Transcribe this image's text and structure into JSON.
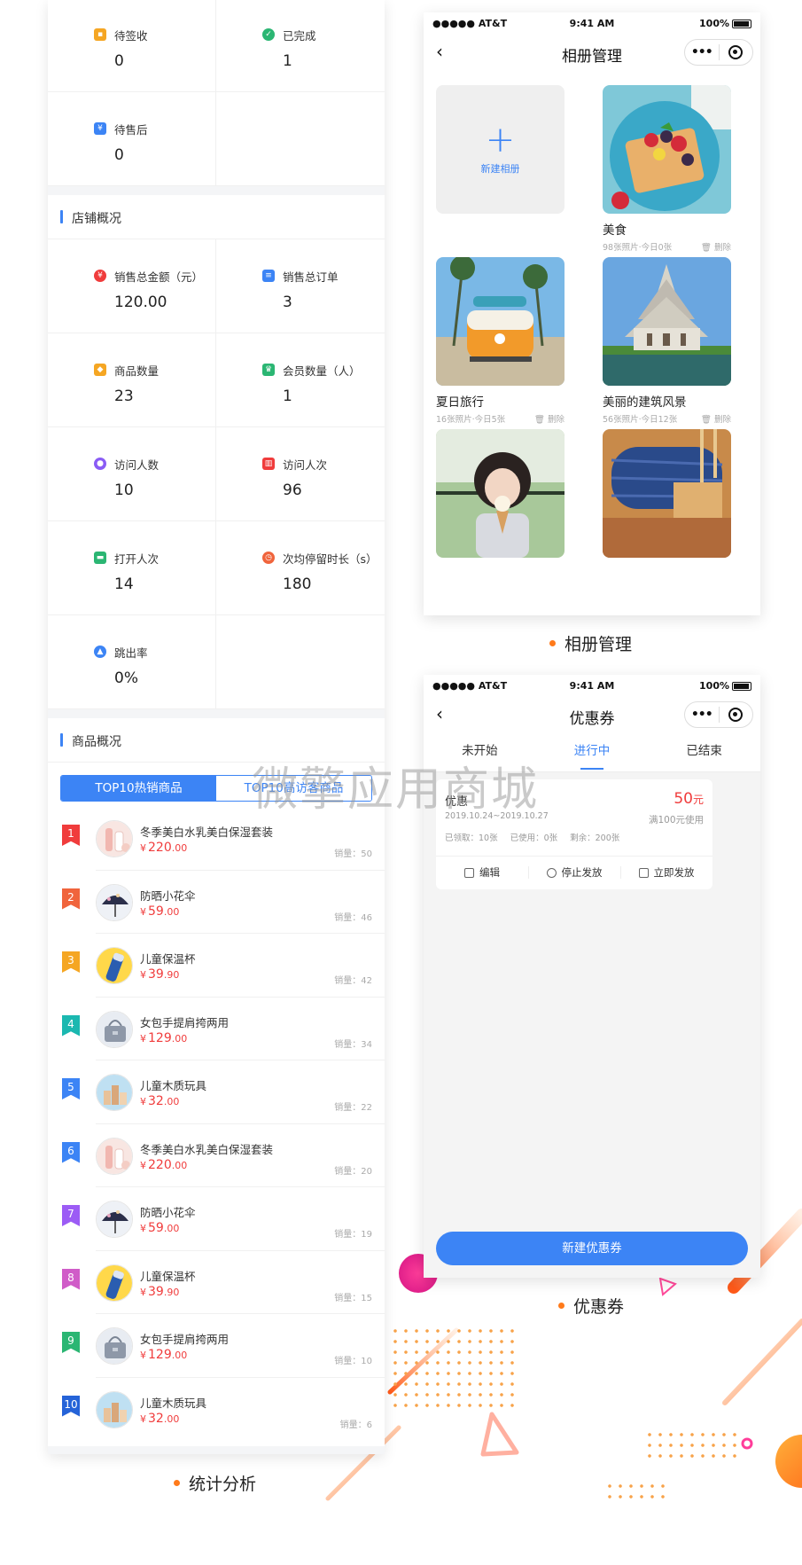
{
  "order_stats": [
    {
      "icon": "pending-receipt-icon",
      "label": "待签收",
      "value": "0",
      "color": "#f5a623"
    },
    {
      "icon": "completed-icon",
      "label": "已完成",
      "value": "1",
      "color": "#2bb673"
    },
    {
      "icon": "after-sales-icon",
      "label": "待售后",
      "value": "0",
      "color": "#3c84f5"
    }
  ],
  "store_overview": {
    "title": "店铺概况",
    "items": [
      {
        "icon": "money-bag-icon",
        "label": "销售总金额（元）",
        "value": "120.00",
        "color": "#f03c3c"
      },
      {
        "icon": "order-list-icon",
        "label": "销售总订单",
        "value": "3",
        "color": "#3c84f5"
      },
      {
        "icon": "product-box-icon",
        "label": "商品数量",
        "value": "23",
        "color": "#f5a623"
      },
      {
        "icon": "crown-icon",
        "label": "会员数量（人）",
        "value": "1",
        "color": "#2bb673"
      },
      {
        "icon": "visitors-icon",
        "label": "访问人数",
        "value": "10",
        "color": "#8a5cf5"
      },
      {
        "icon": "bar-chart-icon",
        "label": "访问人次",
        "value": "96",
        "color": "#f03c3c"
      },
      {
        "icon": "open-icon",
        "label": "打开人次",
        "value": "14",
        "color": "#2bb673"
      },
      {
        "icon": "clock-icon",
        "label": "次均停留时长（s）",
        "value": "180",
        "color": "#f0643c"
      },
      {
        "icon": "bounce-user-icon",
        "label": "跳出率",
        "value": "0%",
        "color": "#3c84f5"
      }
    ]
  },
  "product_overview": {
    "title": "商品概况",
    "tabs": [
      "TOP10热销商品",
      "TOP10高访客商品"
    ],
    "rank_colors": [
      "#f03c3c",
      "#f0643c",
      "#f5a623",
      "#1bb8b0",
      "#3c84f5",
      "#3c84f5",
      "#9c5cf5",
      "#d05cc8",
      "#2bb673",
      "#2563d8"
    ],
    "products": [
      {
        "rank": "1",
        "name": "冬季美白水乳美白保湿套装",
        "currency": "¥",
        "price_int": "220",
        "price_dec": ".00",
        "sales": "销量：50",
        "thumb": "cosmetics"
      },
      {
        "rank": "2",
        "name": "防晒小花伞",
        "currency": "¥",
        "price_int": "59",
        "price_dec": ".00",
        "sales": "销量：46",
        "thumb": "umbrella"
      },
      {
        "rank": "3",
        "name": "儿童保温杯",
        "currency": "¥",
        "price_int": "39",
        "price_dec": ".90",
        "sales": "销量：42",
        "thumb": "cup"
      },
      {
        "rank": "4",
        "name": "女包手提肩挎两用",
        "currency": "¥",
        "price_int": "129",
        "price_dec": ".00",
        "sales": "销量：34",
        "thumb": "bag"
      },
      {
        "rank": "5",
        "name": "儿童木质玩具",
        "currency": "¥",
        "price_int": "32",
        "price_dec": ".00",
        "sales": "销量：22",
        "thumb": "toy"
      },
      {
        "rank": "6",
        "name": "冬季美白水乳美白保湿套装",
        "currency": "¥",
        "price_int": "220",
        "price_dec": ".00",
        "sales": "销量：20",
        "thumb": "cosmetics"
      },
      {
        "rank": "7",
        "name": "防晒小花伞",
        "currency": "¥",
        "price_int": "59",
        "price_dec": ".00",
        "sales": "销量：19",
        "thumb": "umbrella"
      },
      {
        "rank": "8",
        "name": "儿童保温杯",
        "currency": "¥",
        "price_int": "39",
        "price_dec": ".90",
        "sales": "销量：15",
        "thumb": "cup"
      },
      {
        "rank": "9",
        "name": "女包手提肩挎两用",
        "currency": "¥",
        "price_int": "129",
        "price_dec": ".00",
        "sales": "销量：10",
        "thumb": "bag"
      },
      {
        "rank": "10",
        "name": "儿童木质玩具",
        "currency": "¥",
        "price_int": "32",
        "price_dec": ".00",
        "sales": "销量：6",
        "thumb": "toy"
      }
    ]
  },
  "captions": {
    "stats": "统计分析",
    "album": "相册管理",
    "coupon": "优惠券"
  },
  "status_bar": {
    "carrier": "●●●●● AT&T",
    "time": "9:41 AM",
    "battery": "100%"
  },
  "album_page": {
    "title": "相册管理",
    "new_album": "新建相册",
    "albums": [
      {
        "name": "美食",
        "meta": "98张照片·今日0张",
        "delete": "删除",
        "image": "food"
      },
      {
        "name": "夏日旅行",
        "meta": "16张照片·今日5张",
        "delete": "删除",
        "image": "travel"
      },
      {
        "name": "美丽的建筑风景",
        "meta": "56张照片·今日12张",
        "delete": "删除",
        "image": "temple"
      },
      {
        "name": "",
        "meta": "",
        "delete": "",
        "image": "girl"
      },
      {
        "name": "",
        "meta": "",
        "delete": "",
        "image": "thread"
      }
    ]
  },
  "coupon_page": {
    "title": "优惠券",
    "tabs": [
      "未开始",
      "进行中",
      "已结束"
    ],
    "active_tab": "进行中",
    "coupon": {
      "name": "优惠",
      "date": "2019.10.24~2019.10.27",
      "received": "已领取：10张",
      "used": "已使用：0张",
      "remaining": "剩余：200张",
      "amount": "50",
      "amount_unit": "元",
      "condition": "满100元使用"
    },
    "actions": [
      "编辑",
      "停止发放",
      "立即发放"
    ],
    "new_button": "新建优惠券"
  },
  "watermark": "微擎应用商城",
  "colors": {
    "primary": "#3c84f5",
    "price_red": "#f03c3c",
    "accent_orange": "#ff7a1a"
  }
}
